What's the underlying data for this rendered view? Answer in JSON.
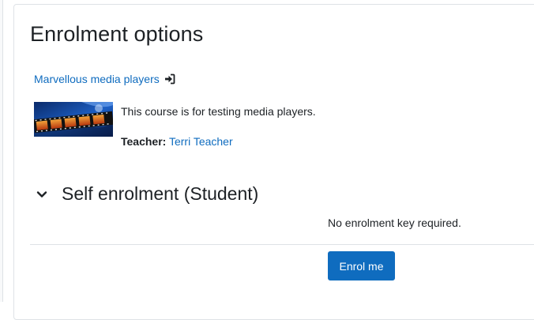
{
  "page": {
    "title": "Enrolment options"
  },
  "course": {
    "name": "Marvellous media players",
    "enter_icon": "sign-in-icon",
    "image_alt": "film-strip-image",
    "summary": "This course is for testing media players.",
    "teacher_label": "Teacher:",
    "teacher_name": "Terri Teacher"
  },
  "self_enrolment": {
    "title": "Self enrolment (Student)",
    "toggle_icon": "chevron-down-icon",
    "key_message": "No enrolment key required.",
    "button_label": "Enrol me"
  },
  "colors": {
    "link": "#0f6cbf",
    "primary_button": "#0f6cbf",
    "text": "#1d2125",
    "border": "#dee2e6"
  }
}
